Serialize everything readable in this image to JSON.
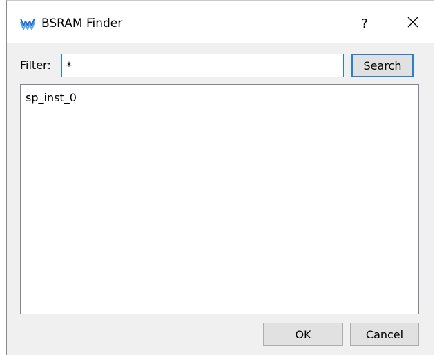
{
  "window": {
    "title": "BSRAM Finder",
    "help_label": "?",
    "icons": {
      "app": "gowin-logo-icon",
      "close": "close-icon"
    },
    "accent_color": "#2a7fd4"
  },
  "filter": {
    "label": "Filter:",
    "value": "*"
  },
  "search_button": {
    "label": "Search"
  },
  "results": {
    "items": [
      "sp_inst_0"
    ]
  },
  "footer": {
    "ok_label": "OK",
    "cancel_label": "Cancel"
  }
}
